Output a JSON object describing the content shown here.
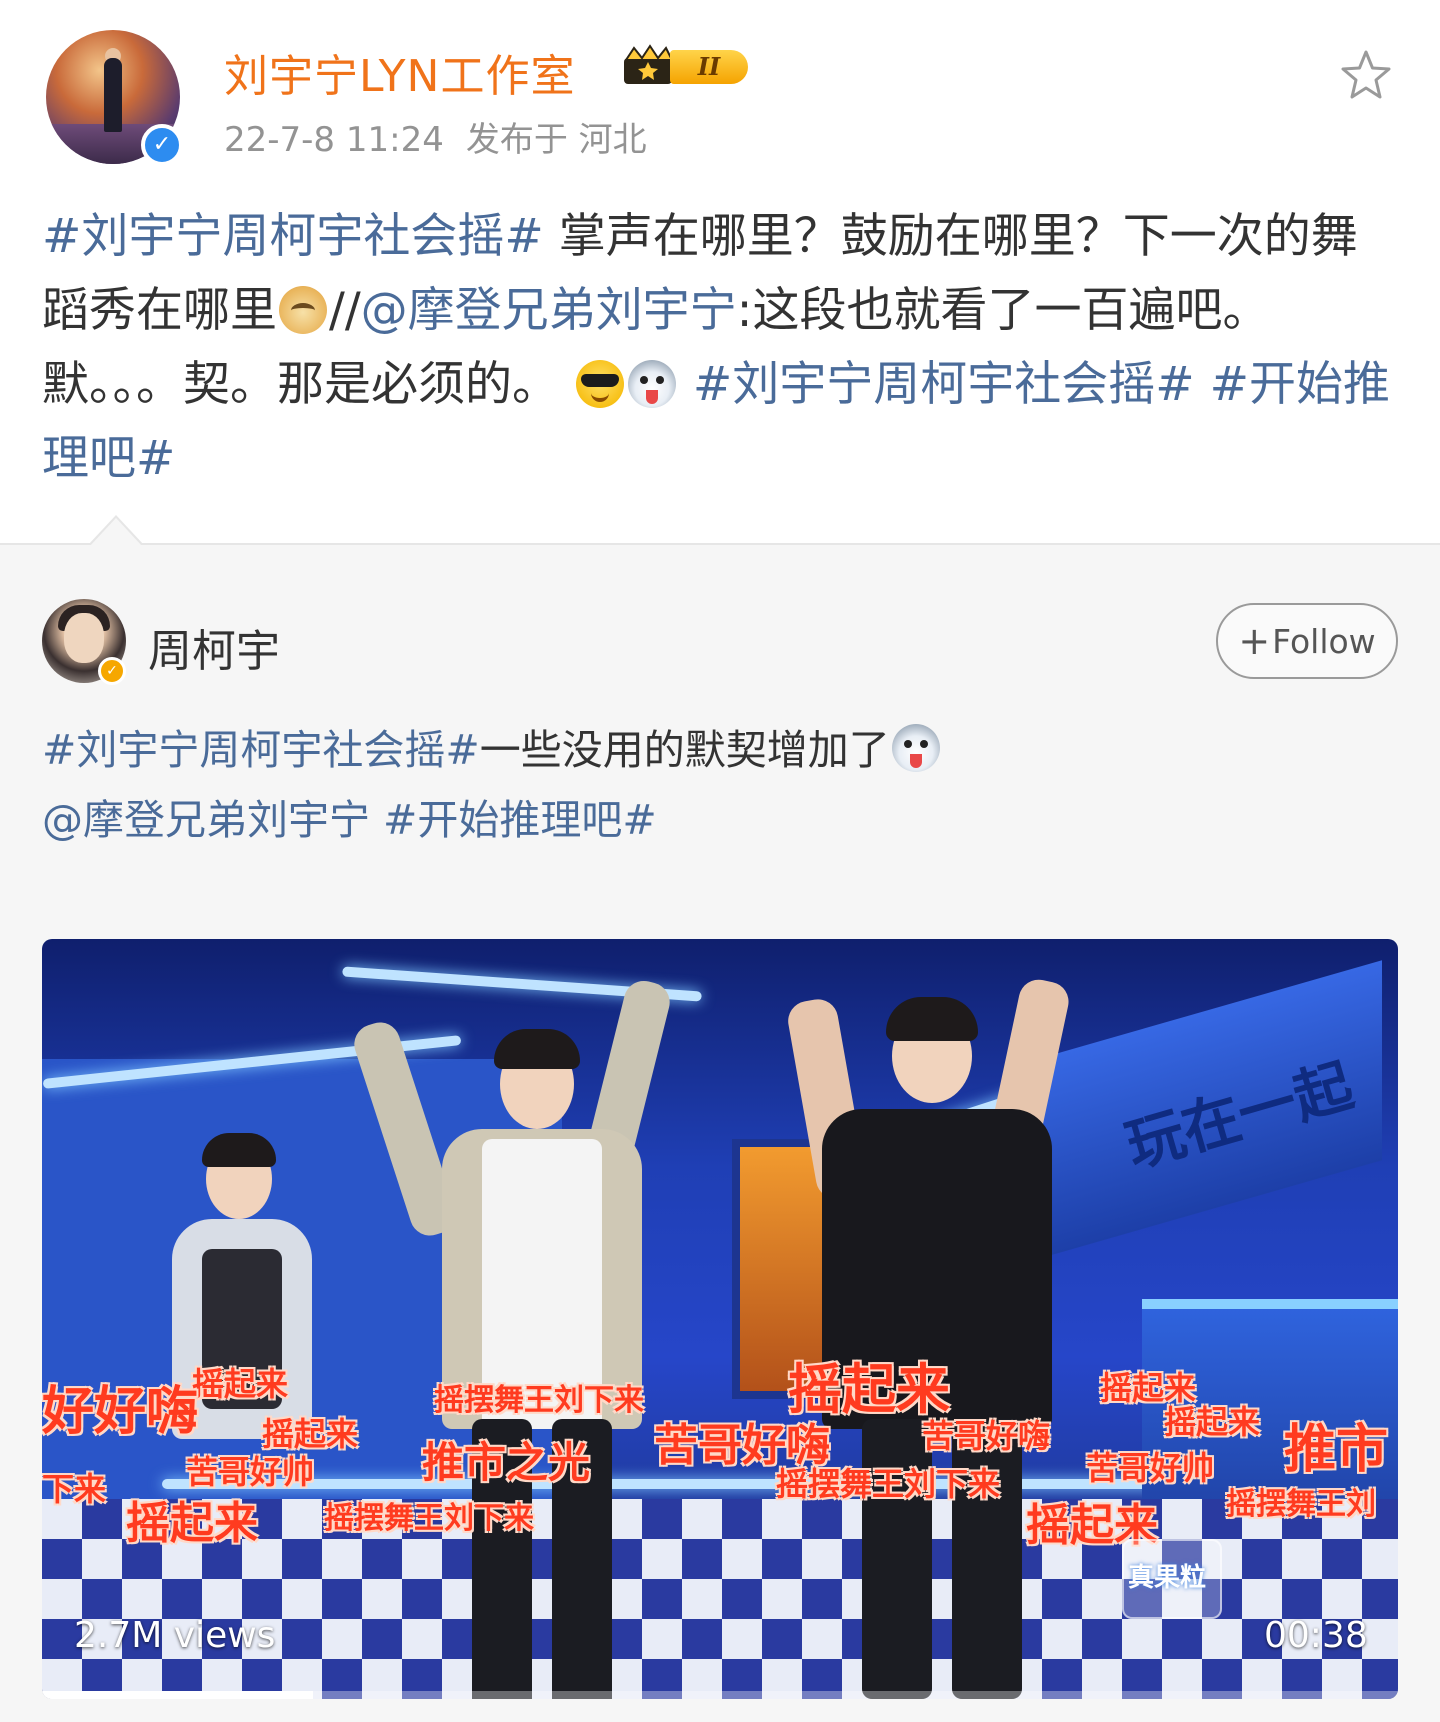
{
  "post": {
    "author": "刘宇宁LYN工作室",
    "member_level": "II",
    "timestamp": "22-7-8 11:24",
    "source": "发布于 河北",
    "body": {
      "tag1": "#刘宇宁周柯宇社会摇#",
      "text1": " 掌声在哪里？鼓励在哪里？下一次的舞蹈秀在哪里",
      "emoji1": "doge",
      "text2": "//",
      "mention": "@摩登兄弟刘宇宁",
      "text3": ":这段也就看了一百遍吧。默。。。契。那是必须的。",
      "emoji2": "cool",
      "emoji3": "husky",
      "tag2": " #刘宇宁周柯宇社会摇#",
      "tag3": "#开始推理吧#"
    },
    "icons": {
      "verified": "verified-blue-icon",
      "star": "star-outline-icon"
    }
  },
  "repost": {
    "author": "周柯宇",
    "follow_label": "Follow",
    "follow_plus": "+",
    "body": {
      "tag1": "#刘宇宁周柯宇社会摇#",
      "text1": "一些没用的默契增加了",
      "emoji1": "husky",
      "mention": "@摩登兄弟刘宇宁",
      "tag2": "#开始推理吧#"
    },
    "video": {
      "views": "2.7M views",
      "duration": "00:38",
      "progress": 0.2,
      "sign_text": "玩在一起",
      "logo_text": "真果粒",
      "danmaku": [
        "摇起来",
        "摇起来",
        "好好嗨",
        "苦哥好帅",
        "下来",
        "摇起来",
        "摇摆舞王刘下来",
        "推市之光",
        "摇摆舞王刘下来",
        "摇起来",
        "苦哥好嗨",
        "苦哥好嗨",
        "摇摆舞王刘下来",
        "摇起来",
        "摇起来",
        "苦哥好帅",
        "推市",
        "摇起来",
        "摇摆舞王刘"
      ]
    }
  },
  "colors": {
    "author_orange": "#f0731a",
    "link_blue": "#4a6b99",
    "danmaku_red": "#ff3b1f"
  }
}
